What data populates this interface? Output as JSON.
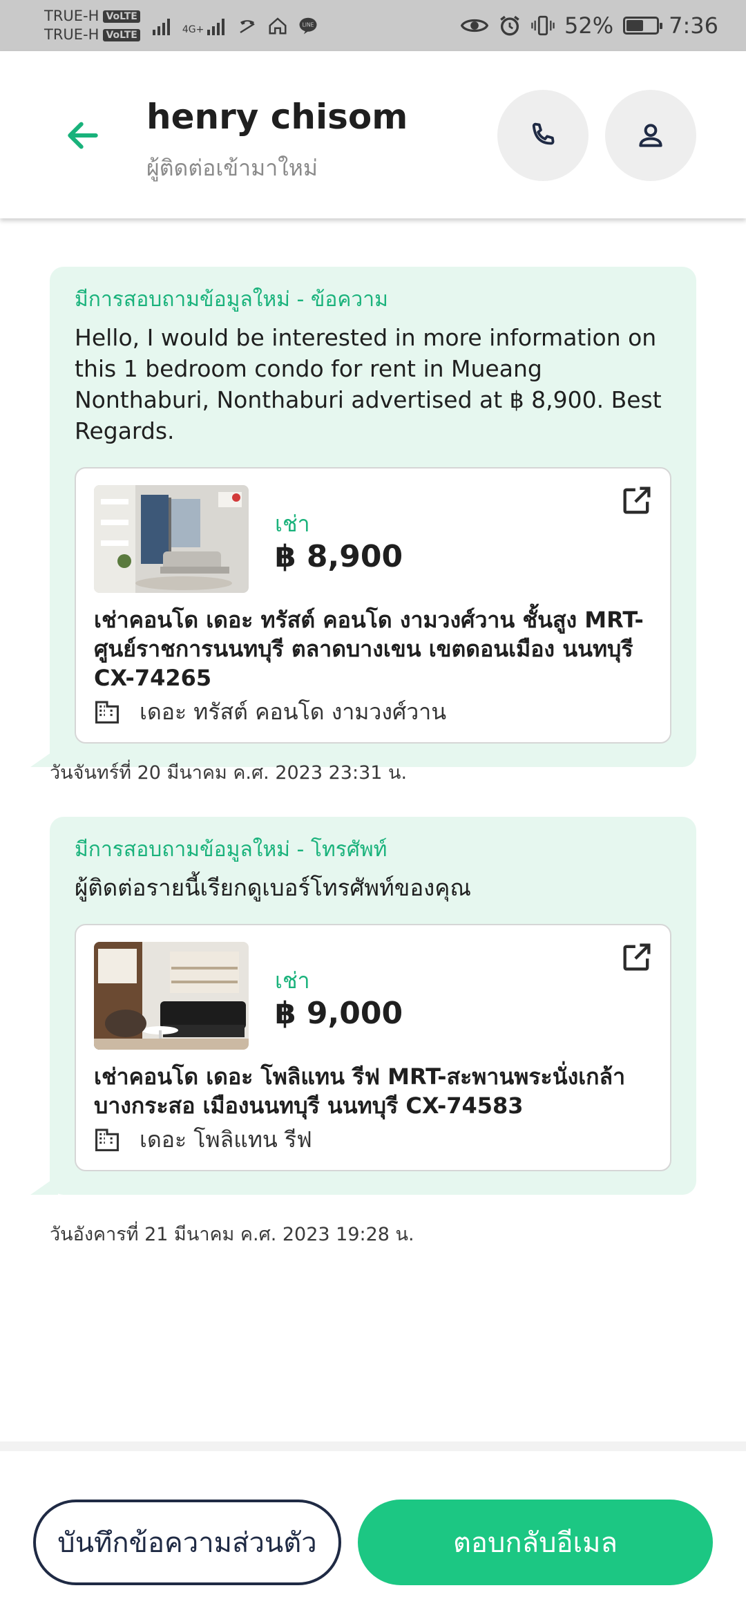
{
  "status_bar": {
    "carrier_1": "TRUE-H",
    "carrier_2": "TRUE-H",
    "volte": "VoLTE",
    "network": "4G+",
    "battery_percent": "52%",
    "battery_level": 0.52,
    "time": "7:36"
  },
  "header": {
    "contact_name": "henry chisom",
    "contact_subtitle": "ผู้ติดต่อเข้ามาใหม่"
  },
  "messages": [
    {
      "label": "มีการสอบถามข้อมูลใหม่ - ข้อความ",
      "text": "Hello, I would be interested in more information on this 1 bedroom condo for rent in Mueang Nonthaburi, Nonthaburi advertised at ฿ 8,900. Best Regards.",
      "listing": {
        "type": "เช่า",
        "price": "฿ 8,900",
        "title": "เช่าคอนโด  เดอะ ทรัสต์ คอนโด งามวงศ์วาน ชั้นสูง MRT-ศูนย์ราชการนนทบุรี ตลาดบางเขน เขตดอนเมือง นนทบุรี CX-74265",
        "project": "เดอะ ทรัสต์ คอนโด งามวงศ์วาน"
      },
      "timestamp": "วันจันทร์ที่ 20 มีนาคม ค.ศ. 2023 23:31 น."
    },
    {
      "label": "มีการสอบถามข้อมูลใหม่ - โทรศัพท์",
      "text": "ผู้ติดต่อรายนี้เรียกดูเบอร์โทรศัพท์ของคุณ",
      "listing": {
        "type": "เช่า",
        "price": "฿ 9,000",
        "title": "เช่าคอนโด  เดอะ โพลิแทน รีฟ MRT-สะพานพระนั่งเกล้า บางกระสอ เมืองนนทบุรี นนทบุรี CX-74583",
        "project": "เดอะ โพลิแทน รีฟ"
      },
      "timestamp": "วันอังคารที่ 21 มีนาคม ค.ศ. 2023 19:28 น."
    }
  ],
  "actions": {
    "private_note": "บันทึกข้อความส่วนตัว",
    "reply_email": "ตอบกลับอีเมล"
  },
  "colors": {
    "accent": "#1cc783",
    "label_green": "#19b27b",
    "bubble_bg": "#e6f7ef",
    "dark_text": "#1f2a44"
  }
}
